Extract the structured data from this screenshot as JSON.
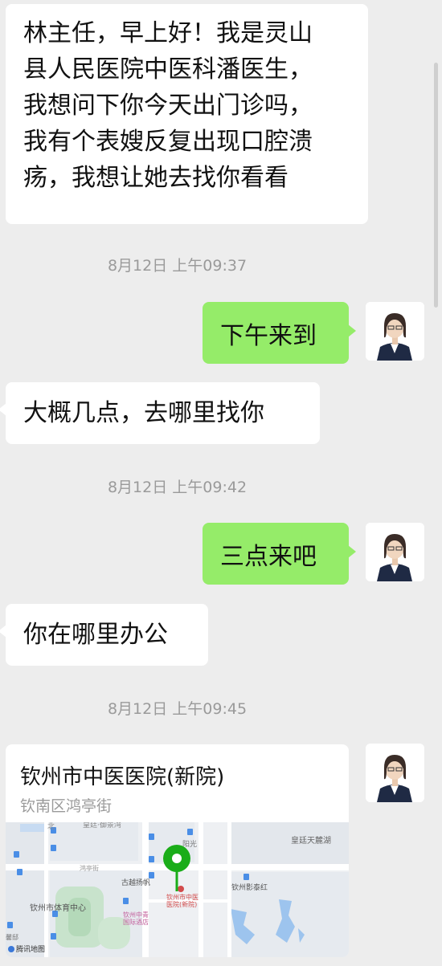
{
  "messages": {
    "m1": {
      "lines": [
        "林主任，早上好！我是灵山",
        "县人民医院中医科潘医生，",
        "我想问下你今天出门诊吗，",
        "我有个表嫂反复出现口腔溃",
        "疡，我想让她去找你看看"
      ]
    },
    "ts1": "8月12日 上午09:37",
    "m2": "下午来到",
    "m3": "大概几点，去哪里找你",
    "ts2": "8月12日 上午09:42",
    "m4": "三点来吧",
    "m5": "你在哪里办公",
    "ts3": "8月12日 上午09:45"
  },
  "location_card": {
    "title": "钦州市中医医院(新院)",
    "address": "钦南区鸿亭街",
    "map": {
      "labels": {
        "hospital": [
          "钦州市中医",
          "医院(新院)"
        ],
        "stadium": "钦州市体育中心",
        "hotel": [
          "钦州中青",
          "国际酒店"
        ],
        "lake": "皇廷天麓湖",
        "yinghong": "钦州影泰红",
        "gujie": "古越扬帆",
        "road1": "鸿亭街",
        "road_top": "皇廷·御景湾",
        "yangguang": "阳光",
        "bei": "北",
        "bottom_left": "馨邸"
      },
      "provider": "腾讯地图",
      "pin_color": "#1aad19"
    }
  },
  "colors": {
    "bg": "#ededed",
    "self_bubble": "#95ec69",
    "other_bubble": "#ffffff"
  }
}
